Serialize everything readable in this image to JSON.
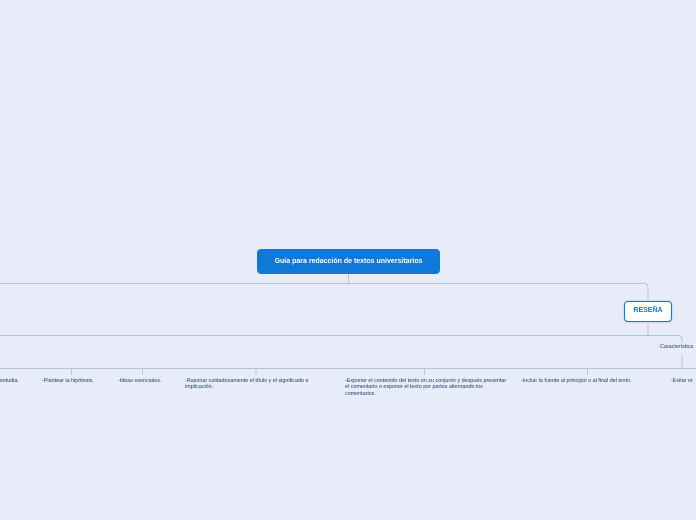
{
  "root": {
    "title": "Guía para redacción de textos universitarios"
  },
  "branch": {
    "title": "RESEÑA",
    "sub_label": "Característica"
  },
  "items": [
    "estudia.",
    "-Plantear la hipótesis.",
    "-Ideas esenciales.",
    "-Razonar cuidadosamente el título y el significado e implicación.",
    "-Exponer el contenido del texto en su conjunto y después presentar el comentario o exponer el texto por partes alternando los comentarios.",
    "-Incluir la fuente al principio o al final del texto.",
    "-Evitar re"
  ],
  "colors": {
    "background": "#e8ecf9",
    "accent": "#0f78d9",
    "connector": "#b9c3d6",
    "text": "#223a66"
  }
}
